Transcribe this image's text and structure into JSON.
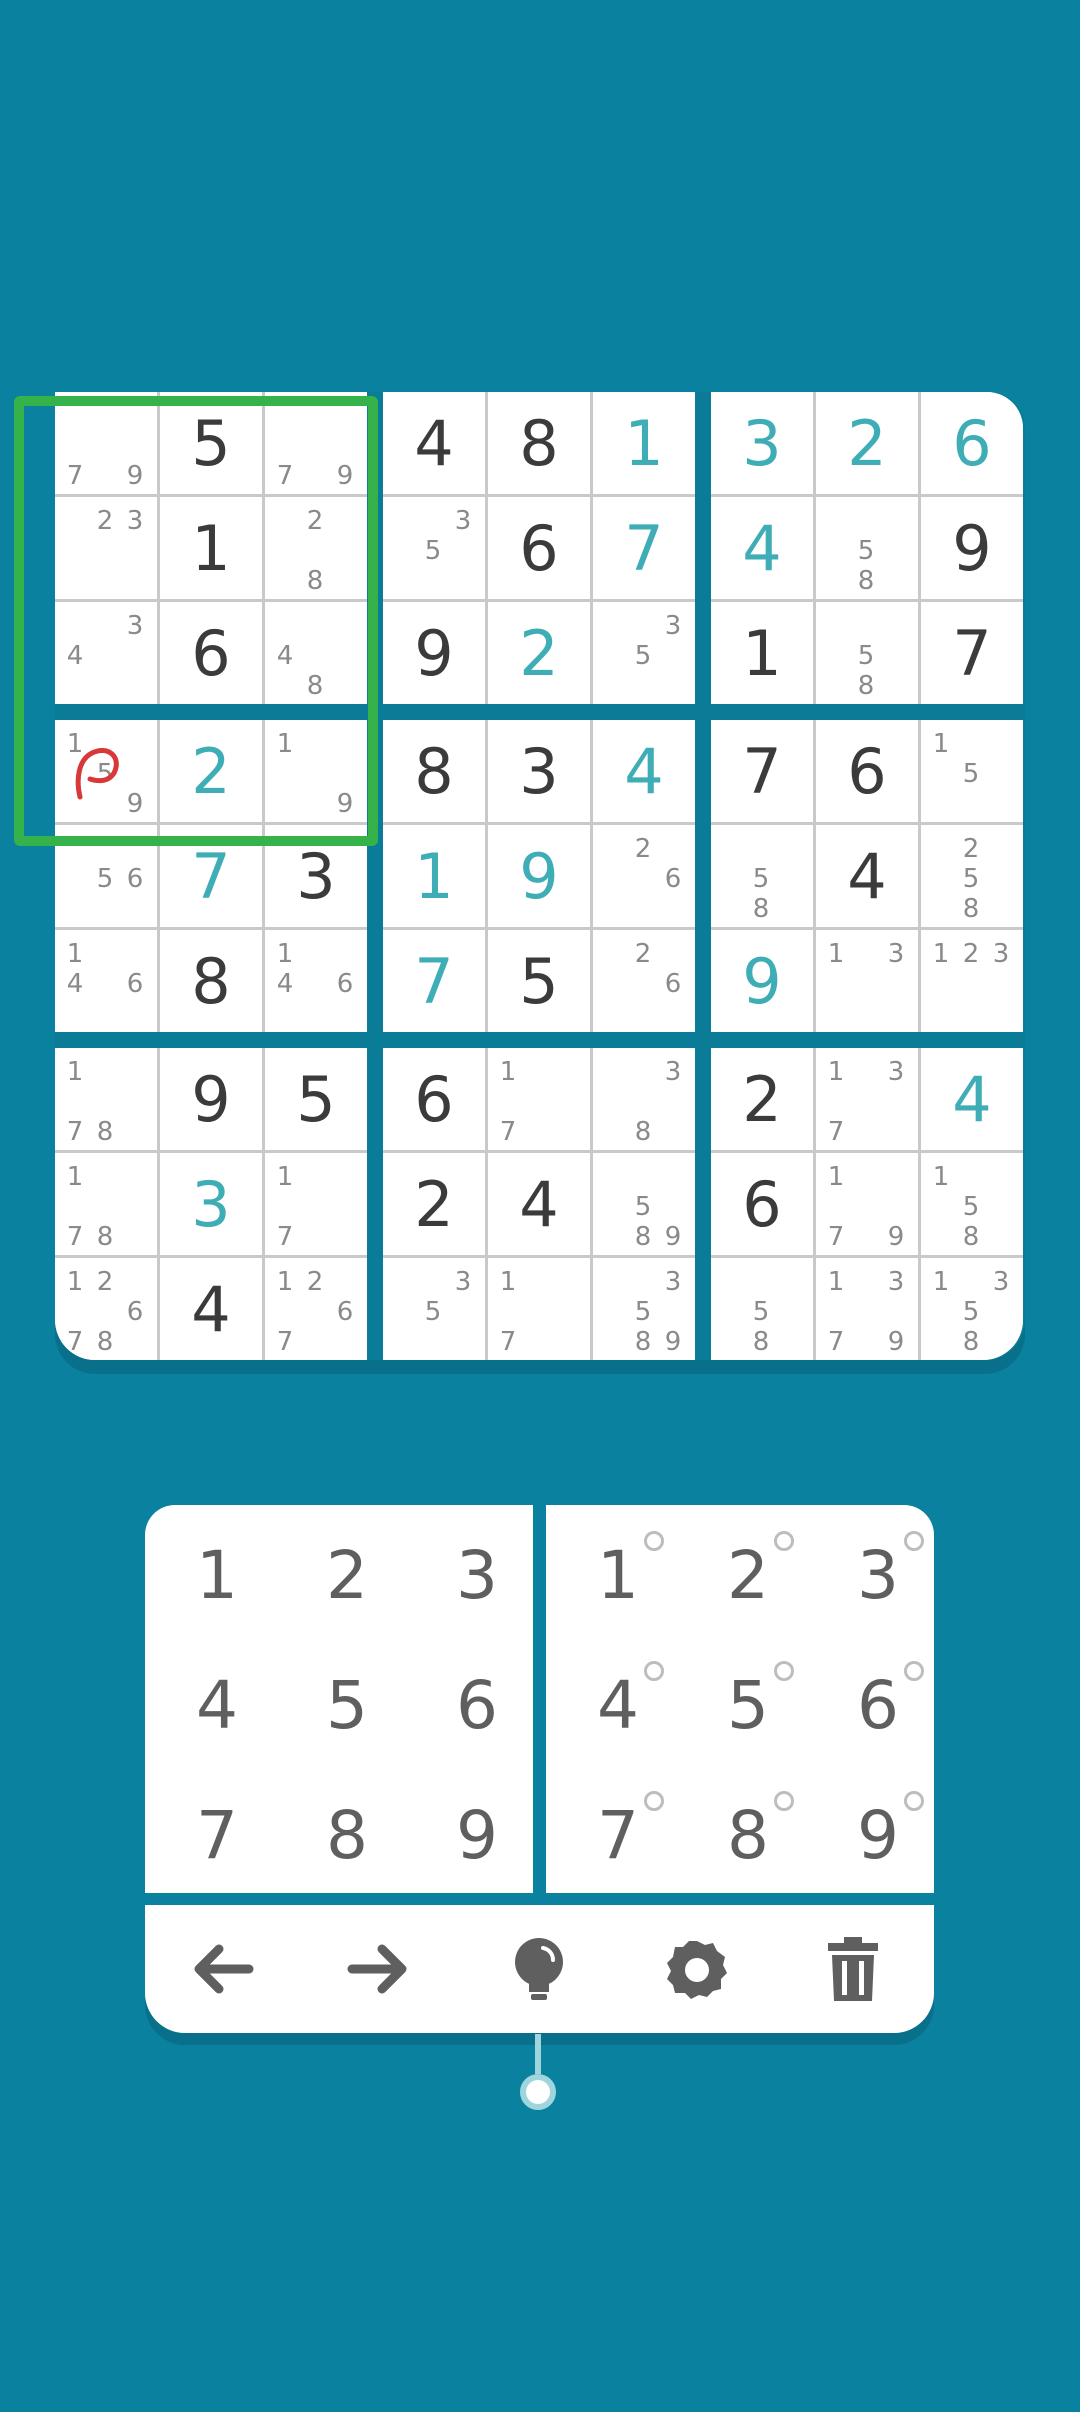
{
  "theme": {
    "background": "#0a819f",
    "given_color": "#3b3b3b",
    "user_color": "#3fadb6",
    "selection_color": "#36b24a",
    "candidate_color": "#8a8a8a"
  },
  "board": [
    [
      {
        "c": [
          7,
          9
        ]
      },
      {
        "v": "5",
        "t": "g"
      },
      {
        "c": [
          7,
          9
        ]
      },
      {
        "v": "4",
        "t": "g"
      },
      {
        "v": "8",
        "t": "g"
      },
      {
        "v": "1",
        "t": "u"
      },
      {
        "v": "3",
        "t": "u"
      },
      {
        "v": "2",
        "t": "u"
      },
      {
        "v": "6",
        "t": "u"
      }
    ],
    [
      {
        "c": [
          2,
          3
        ]
      },
      {
        "v": "1",
        "t": "g"
      },
      {
        "c": [
          2,
          8
        ]
      },
      {
        "c": [
          3,
          5
        ]
      },
      {
        "v": "6",
        "t": "g"
      },
      {
        "v": "7",
        "t": "u"
      },
      {
        "v": "4",
        "t": "u"
      },
      {
        "c": [
          5,
          8
        ]
      },
      {
        "v": "9",
        "t": "g"
      }
    ],
    [
      {
        "c": [
          3,
          4
        ]
      },
      {
        "v": "6",
        "t": "g"
      },
      {
        "c": [
          4,
          8
        ]
      },
      {
        "v": "9",
        "t": "g"
      },
      {
        "v": "2",
        "t": "u"
      },
      {
        "c": [
          3,
          5
        ]
      },
      {
        "v": "1",
        "t": "g"
      },
      {
        "c": [
          5,
          8
        ]
      },
      {
        "v": "7",
        "t": "g"
      }
    ],
    [
      {
        "c": [
          1,
          5,
          9
        ]
      },
      {
        "v": "2",
        "t": "u"
      },
      {
        "c": [
          1,
          9
        ]
      },
      {
        "v": "8",
        "t": "g"
      },
      {
        "v": "3",
        "t": "g"
      },
      {
        "v": "4",
        "t": "u"
      },
      {
        "v": "7",
        "t": "g"
      },
      {
        "v": "6",
        "t": "g"
      },
      {
        "c": [
          1,
          5
        ]
      }
    ],
    [
      {
        "c": [
          5,
          6
        ]
      },
      {
        "v": "7",
        "t": "u"
      },
      {
        "v": "3",
        "t": "g"
      },
      {
        "v": "1",
        "t": "u"
      },
      {
        "v": "9",
        "t": "u"
      },
      {
        "c": [
          2,
          6
        ]
      },
      {
        "c": [
          5,
          8
        ]
      },
      {
        "v": "4",
        "t": "g"
      },
      {
        "c": [
          2,
          5,
          8
        ]
      }
    ],
    [
      {
        "c": [
          1,
          4,
          6
        ]
      },
      {
        "v": "8",
        "t": "g"
      },
      {
        "c": [
          1,
          4,
          6
        ]
      },
      {
        "v": "7",
        "t": "u"
      },
      {
        "v": "5",
        "t": "g"
      },
      {
        "c": [
          2,
          6
        ]
      },
      {
        "v": "9",
        "t": "u"
      },
      {
        "c": [
          1,
          3
        ]
      },
      {
        "c": [
          1,
          2,
          3
        ]
      }
    ],
    [
      {
        "c": [
          1,
          7,
          8
        ]
      },
      {
        "v": "9",
        "t": "g"
      },
      {
        "v": "5",
        "t": "g"
      },
      {
        "v": "6",
        "t": "g"
      },
      {
        "c": [
          1,
          7
        ]
      },
      {
        "c": [
          3,
          8
        ]
      },
      {
        "v": "2",
        "t": "g"
      },
      {
        "c": [
          1,
          3,
          7
        ]
      },
      {
        "v": "4",
        "t": "u"
      }
    ],
    [
      {
        "c": [
          1,
          7,
          8
        ]
      },
      {
        "v": "3",
        "t": "u"
      },
      {
        "c": [
          1,
          7
        ]
      },
      {
        "v": "2",
        "t": "g"
      },
      {
        "v": "4",
        "t": "g"
      },
      {
        "c": [
          5,
          8,
          9
        ]
      },
      {
        "v": "6",
        "t": "g"
      },
      {
        "c": [
          1,
          7,
          9
        ]
      },
      {
        "c": [
          1,
          5,
          8
        ]
      }
    ],
    [
      {
        "c": [
          1,
          2,
          6,
          7,
          8
        ]
      },
      {
        "v": "4",
        "t": "g"
      },
      {
        "c": [
          1,
          2,
          6,
          7
        ]
      },
      {
        "c": [
          3,
          5
        ]
      },
      {
        "c": [
          1,
          7
        ]
      },
      {
        "c": [
          3,
          5,
          8,
          9
        ]
      },
      {
        "c": [
          5,
          8
        ]
      },
      {
        "c": [
          1,
          3,
          7,
          9
        ]
      },
      {
        "c": [
          1,
          3,
          5,
          8
        ]
      }
    ]
  ],
  "keypad": {
    "digits": [
      "1",
      "2",
      "3",
      "4",
      "5",
      "6",
      "7",
      "8",
      "9"
    ],
    "candidate_digits": [
      "1",
      "2",
      "3",
      "4",
      "5",
      "6",
      "7",
      "8",
      "9"
    ]
  },
  "toolbar": [
    {
      "name": "undo-icon"
    },
    {
      "name": "redo-icon"
    },
    {
      "name": "hint-bulb-icon"
    },
    {
      "name": "settings-gear-icon"
    },
    {
      "name": "trash-icon"
    }
  ]
}
